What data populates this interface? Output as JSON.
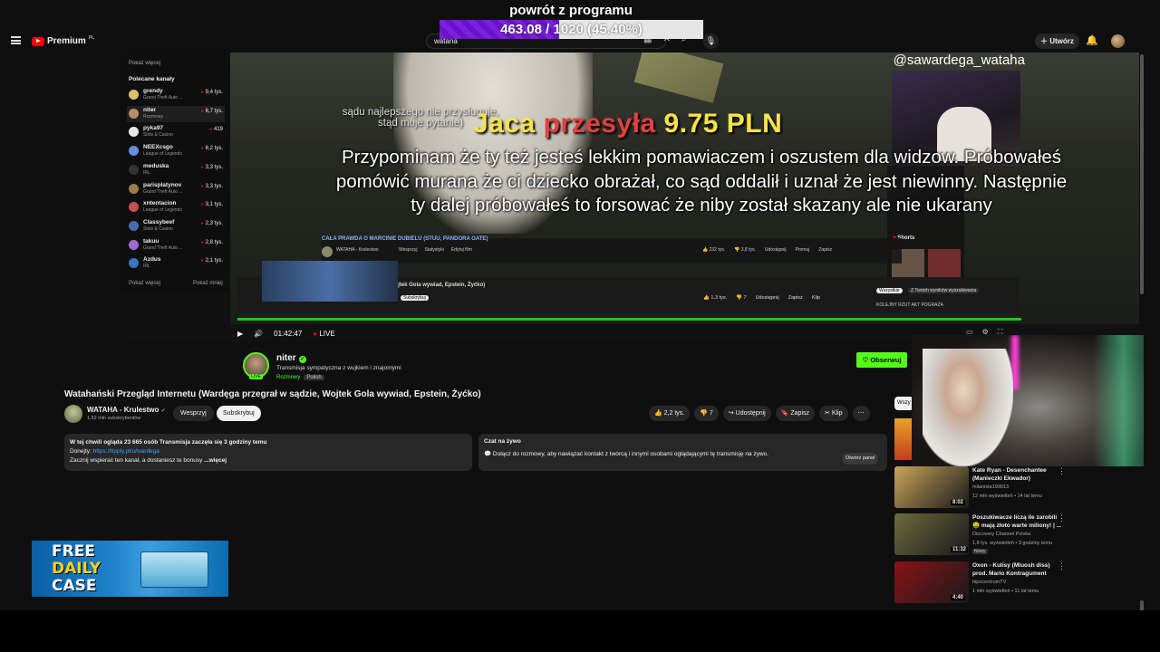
{
  "overlay": {
    "title": "powrót z programu",
    "progress_text": "463.08 / 1020 (45.40%)",
    "progress_fraction": 0.454
  },
  "topbar": {
    "brand": "Premium",
    "region": "PL",
    "search_value": "watana",
    "create_label": "Utwórz"
  },
  "sidebar": {
    "show_more_top": "Pokaż więcej",
    "section_title": "Polecane kanały",
    "channels": [
      {
        "name": "grendy",
        "game": "Grand Theft Auto ...",
        "viewers": "9,4 tys.",
        "color": "#d6c26a"
      },
      {
        "name": "niter",
        "game": "Rozmowy",
        "viewers": "6,7 tys.",
        "color": "#b58f6c"
      },
      {
        "name": "pyka97",
        "game": "Slots & Casino",
        "viewers": "419",
        "color": "#e7e7e7"
      },
      {
        "name": "NEEXcsgo",
        "game": "League of Legends",
        "viewers": "6,2 tys.",
        "color": "#6a8bd9"
      },
      {
        "name": "meduska",
        "game": "IRL",
        "viewers": "3,3 tys.",
        "color": "#333333"
      },
      {
        "name": "parisplatynov",
        "game": "Grand Theft Auto ...",
        "viewers": "3,3 tys.",
        "color": "#9c7b4a"
      },
      {
        "name": "xntentacion",
        "game": "League of Legends",
        "viewers": "3,1 tys.",
        "color": "#c45050"
      },
      {
        "name": "Classybeef",
        "game": "Slots & Casino",
        "viewers": "2,3 tys.",
        "color": "#4c6eb0"
      },
      {
        "name": "takuu",
        "game": "Grand Theft Auto ...",
        "viewers": "2,8 tys.",
        "color": "#9e6bd1"
      },
      {
        "name": "Azdus",
        "game": "IRL",
        "viewers": "2,1 tys.",
        "color": "#3a74c4"
      }
    ],
    "show_more": "Pokaż więcej",
    "show_less": "Pokaż mniej"
  },
  "video": {
    "handle": "@sawardega_wataha",
    "inner_text": "sądu najlepszego nie przysługuje, stąd moje pytanie)",
    "donation_prefix": "Jaca",
    "donation_mid": "przesyła",
    "donation_amount": "9.75 PLN",
    "caption": "Przypominam że ty też jesteś lekkim pomawiaczem i oszustem dla widzow. Próbowałeś pomówić murana że ci dziecko obrażał, co sąd oddalił i uznał że jest niewinny. Następnie ty dalej próbowałeś to forsować że niby został skazany ale nie ukarany",
    "embed_title": "CAŁA PRAWDA O MARCINIE DUBIELU (STUU, PANDORA GATE)",
    "embed_channel": "WATAHA - Krulestwo",
    "embed_buttons": [
      "Wesprzyj",
      "Statystyki",
      "Edytuj film"
    ],
    "embed_likes": "232 tys.",
    "embed_dislikes": "3,8 tys.",
    "embed_actions": [
      "Udostępnij",
      "Promuj",
      "Zapisz"
    ],
    "embed_title2": "przegrał w sądzie, Wojtek Gola wywiad, Epstein, Żyćko)",
    "embed_sub": "Subskrybuj",
    "embed_likes2": "1,3 tys.",
    "embed_dislikes2": "7",
    "embed_actions2": [
      "Udostępnij",
      "Zapisz",
      "Klip"
    ],
    "filter_all": "Wszystkie",
    "filter_other": "Z Twoich wyników wyszukiwania",
    "shorts": "Shorts",
    "sidebar_snippet": "KOLEJNY RZUT AKT POGRAŻA",
    "time": "01:42:47",
    "live": "LIVE"
  },
  "streamer": {
    "name": "niter",
    "live_badge": "LIVE",
    "title": "Transmisja sympatyczna z wujkiem i znajomymi",
    "category": "Rozmowy",
    "language": "Polish",
    "follow": "Obserwuj"
  },
  "yt": {
    "title": "Watahański Przegląd Internetu (Wardęga przegrał w sądzie, Wojtek Gola wywiad, Epstein, Żyćko)",
    "channel": "WATAHA - Krulestwo",
    "subs": "1,62 mln subskrybentów",
    "support": "Wesprzyj",
    "subscribe": "Subskrybuj",
    "likes": "2,2 tys.",
    "dislikes": "7",
    "share": "Udostępnij",
    "save": "Zapisz",
    "clip": "Klip",
    "desc_line1": "W tej chwili ogląda 23 665 osób  Transmisja zaczęła się 3 godziny temu",
    "desc_donate_label": "Donejty:",
    "desc_link": "https://tipply.pl/u/wardega",
    "desc_line3": "Zacznij wspierać ten kanał, a dostaniesz te bonusy",
    "desc_more": "...więcej",
    "chat_title": "Czat na żywo",
    "chat_text": "Dołącz do rozmowy, aby nawiązać kontakt z twórcą i innymi osobami oglądającymi tę transmisję na żywo.",
    "chat_open": "Otwórz panel",
    "filter_pill": "Wszy"
  },
  "related": [
    {
      "title": "Kate Ryan - Desenchantee (Manieczki Ekwador)",
      "channel": "milanista199013",
      "meta": "12 mln wyświetleń • 14 lat temu",
      "duration": "8:02",
      "thumb": "#c9a55a",
      "badge": ""
    },
    {
      "title": "Poszukiwacze liczą ile zarobili 🤑 mają złoto warte miliony! | ...",
      "channel": "Discovery Channel Polska",
      "meta": "1,8 tys. wyświetleń • 3 godziny temu",
      "duration": "11:32",
      "thumb": "#6d6a3e",
      "badge": "Nowy"
    },
    {
      "title": "Oxon - Kulisy (Mluosh diss) prod. Mario Kontragument",
      "channel": "hipocentrumTV",
      "meta": "1 mln wyświetleń • 11 lat temu",
      "duration": "4:40",
      "thumb": "#8a1218",
      "badge": ""
    }
  ],
  "ad": {
    "line1": "FREE",
    "line2": "DAILY",
    "line3": "CASE"
  }
}
